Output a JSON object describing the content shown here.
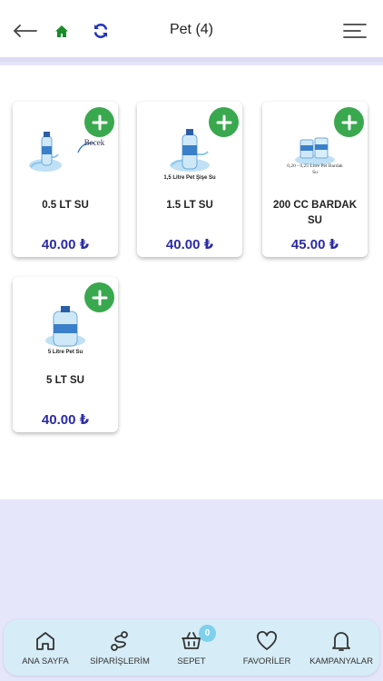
{
  "header": {
    "title": "Pet (4)",
    "icons": {
      "back": "back-arrow-icon",
      "home": "home-icon",
      "refresh": "refresh-icon",
      "menu": "menu-icon"
    }
  },
  "products": [
    {
      "name": "0.5 LT SU",
      "price": "40.00 ₺",
      "image_caption": "",
      "image_brand": "Becek"
    },
    {
      "name": "1.5 LT SU",
      "price": "40.00 ₺",
      "image_caption": "1,5 Litre Pet Şişe Su"
    },
    {
      "name": "200 CC BARDAK SU",
      "price": "45.00 ₺",
      "image_caption": "0,20 - 0,25 Litre Pet Bardak Su"
    },
    {
      "name": "5 LT SU",
      "price": "40.00 ₺",
      "image_caption": "5 Litre Pet Su"
    }
  ],
  "nav": {
    "home_label": "ANA SAYFA",
    "orders_label": "SİPARİŞLERİM",
    "cart_label": "SEPET",
    "cart_count": "0",
    "favorites_label": "FAVORİLER",
    "campaigns_label": "KAMPANYALAR"
  },
  "colors": {
    "accent": "#2a2aa6",
    "add_button": "#3aa84e",
    "home_icon": "#1a8a2a",
    "refresh_icon": "#2233bb",
    "nav_bg": "#d6ecf6",
    "badge": "#7ed0ec"
  }
}
